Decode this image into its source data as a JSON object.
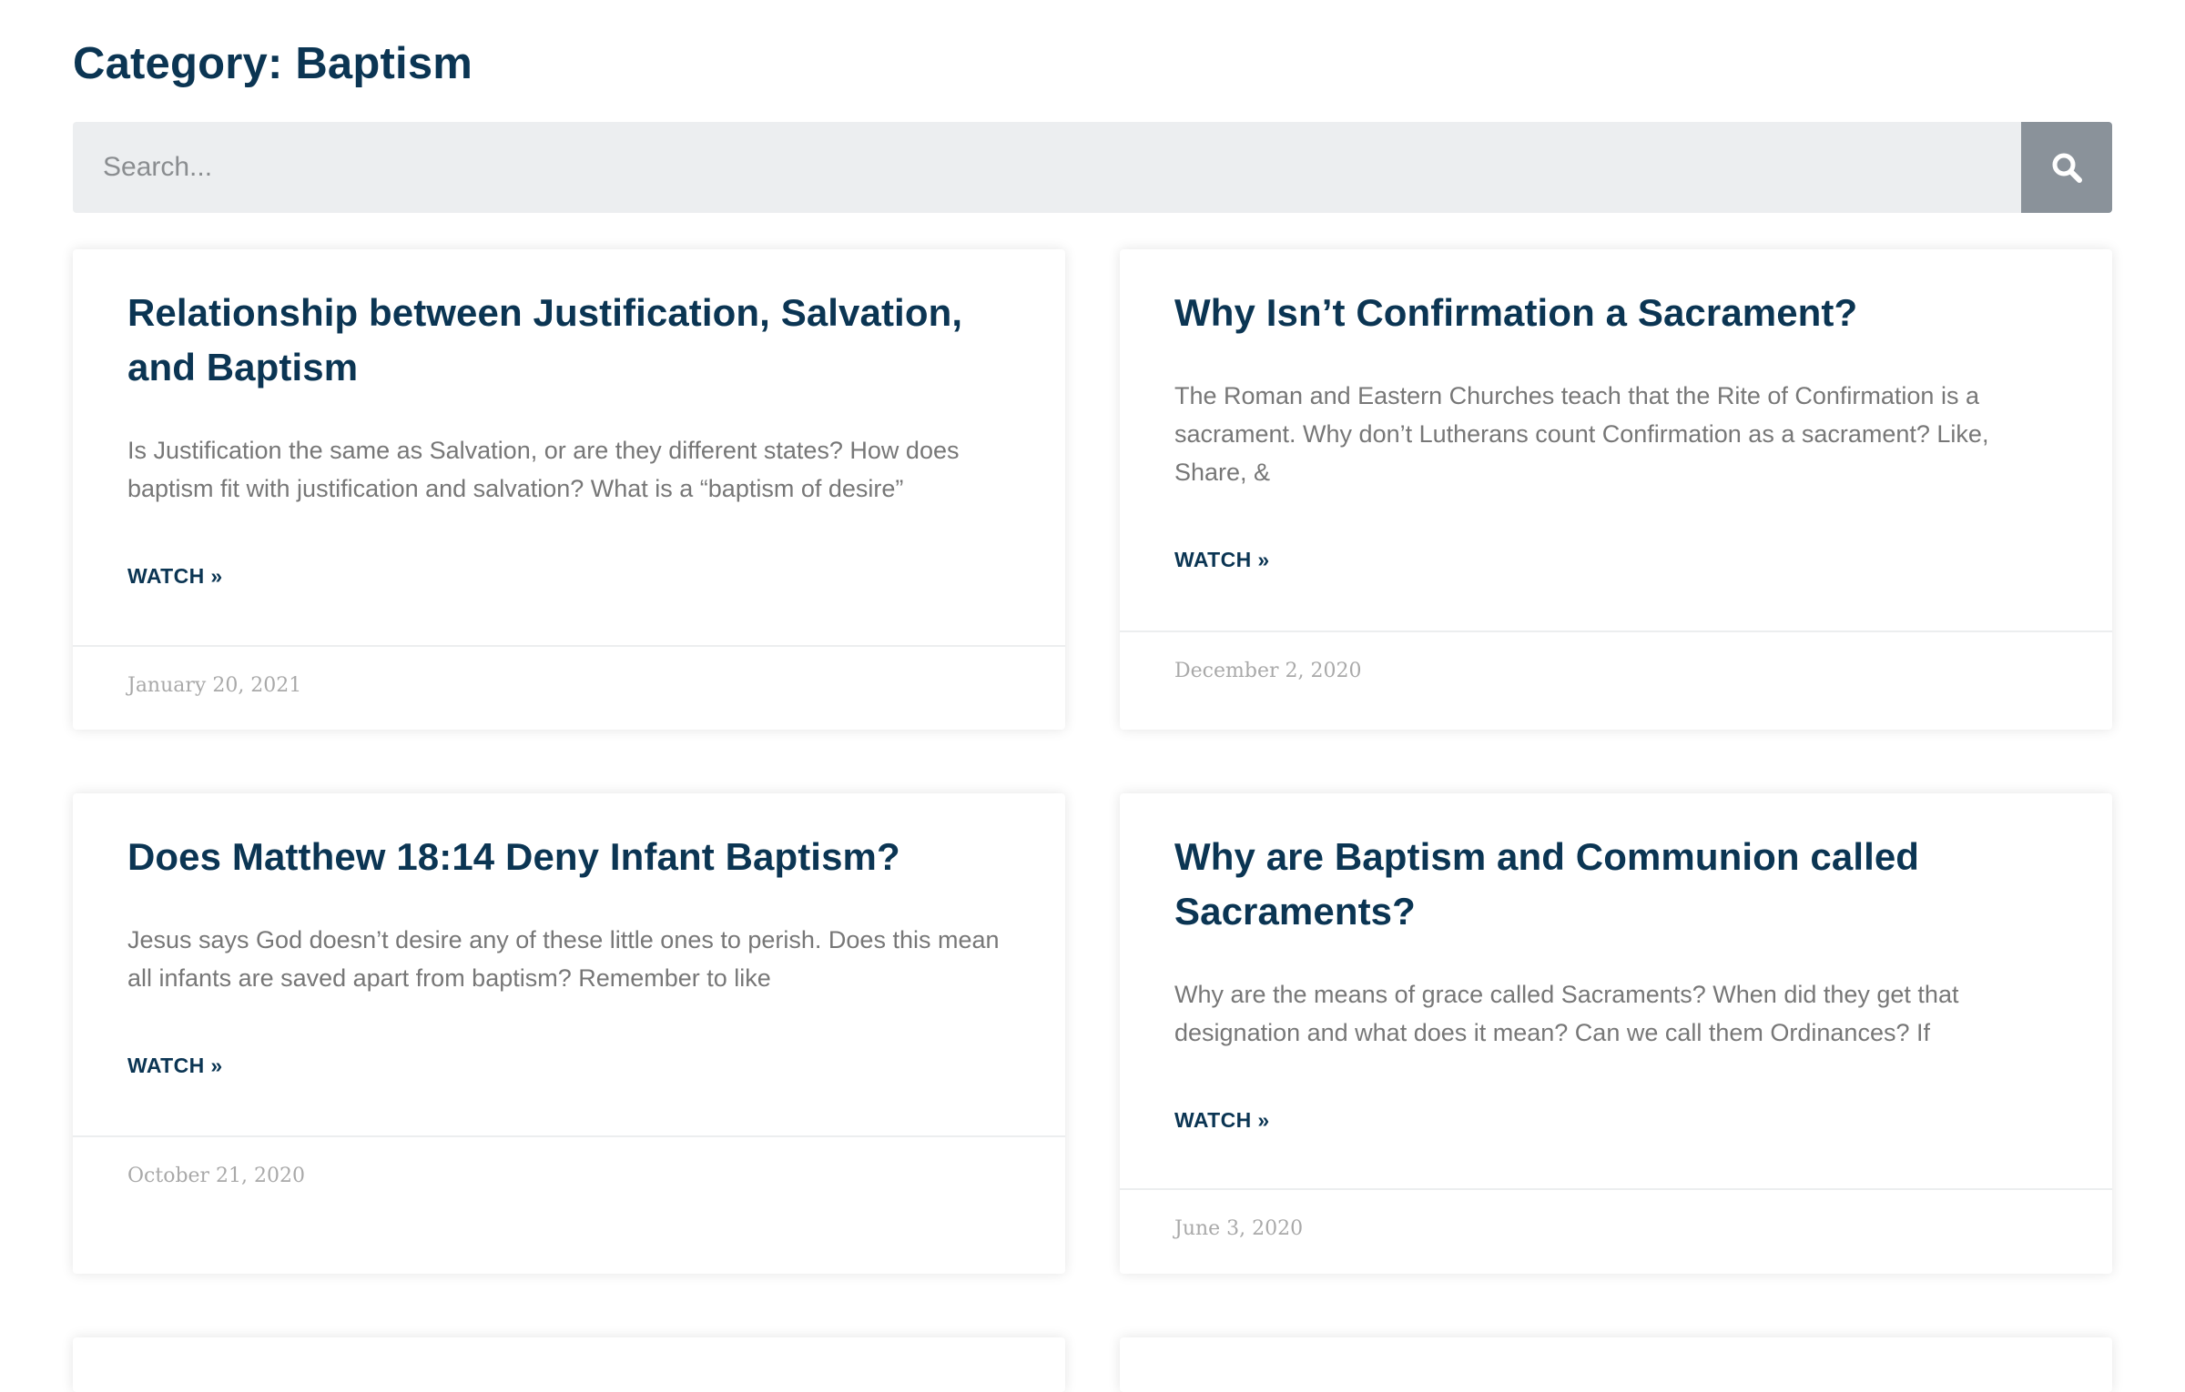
{
  "page": {
    "title": "Category: Baptism"
  },
  "search": {
    "placeholder": "Search...",
    "button_icon": "search-icon"
  },
  "colors": {
    "heading": "#0b3553",
    "excerpt": "#777777",
    "date": "#a9a9a9",
    "search_background": "#eceef0",
    "search_button": "#8a929a"
  },
  "posts": [
    {
      "title": "Relationship between Justification, Salvation, and Baptism",
      "excerpt": "Is Justification the same as Salvation, or are they different states? How does baptism fit with justification and salvation? What is a “baptism of desire”",
      "link_label": "WATCH »",
      "date": "January 20, 2021"
    },
    {
      "title": "Why Isn’t Confirmation a Sacrament?",
      "excerpt": "The Roman and Eastern Churches teach that the Rite of Confirmation is a sacrament. Why don’t Lutherans count Confirmation as a sacrament? Like, Share, &",
      "link_label": "WATCH »",
      "date": "December 2, 2020"
    },
    {
      "title": "Does Matthew 18:14 Deny Infant Baptism?",
      "excerpt": "Jesus says God doesn’t desire any of these little ones to perish. Does this mean all infants are saved apart from baptism? Remember to like",
      "link_label": "WATCH »",
      "date": "October 21, 2020"
    },
    {
      "title": "Why are Baptism and Communion called Sacraments?",
      "excerpt": "Why are the means of grace called Sacraments? When did they get that designation and what does it mean? Can we call them Ordinances? If",
      "link_label": "WATCH »",
      "date": "June 3, 2020"
    }
  ]
}
